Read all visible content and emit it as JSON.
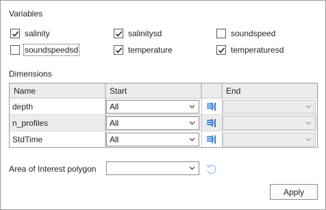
{
  "variables": {
    "title": "Variables",
    "items": [
      {
        "label": "salinity",
        "checked": true
      },
      {
        "label": "salinitysd",
        "checked": true
      },
      {
        "label": "soundspeed",
        "checked": false
      },
      {
        "label": "soundspeedsd",
        "checked": false
      },
      {
        "label": "temperature",
        "checked": true
      },
      {
        "label": "temperaturesd",
        "checked": true
      }
    ]
  },
  "dimensions": {
    "title": "Dimensions",
    "columns": {
      "name": "Name",
      "start": "Start",
      "end": "End"
    },
    "rows": [
      {
        "name": "depth",
        "start": "All",
        "end": ""
      },
      {
        "name": "n_profiles",
        "start": "All",
        "end": ""
      },
      {
        "name": "StdTime",
        "start": "All",
        "end": ""
      }
    ]
  },
  "aoi": {
    "label": "Area of Interest polygon",
    "value": ""
  },
  "apply_label": "Apply",
  "colors": {
    "accent": "#1f6fd1",
    "border": "#9a9a9a",
    "header_bg": "#ececec"
  },
  "icons": {
    "set_end": "arrow-to-end-icon",
    "refresh": "refresh-icon",
    "dropdown": "chevron-down-icon"
  }
}
